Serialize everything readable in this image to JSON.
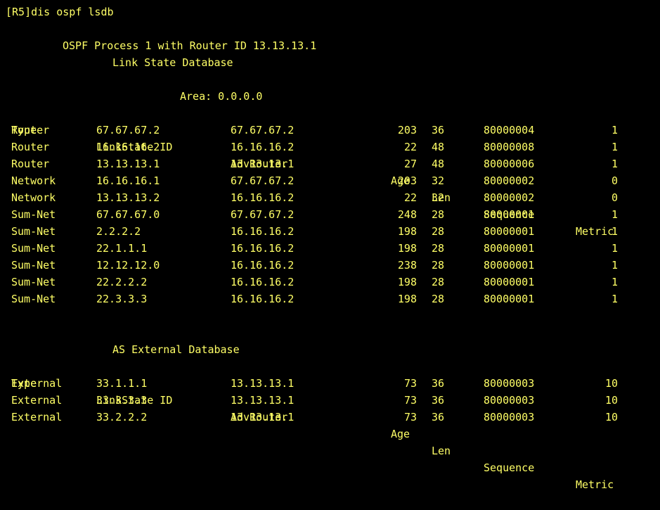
{
  "colors": {
    "background": "#000000",
    "text": "#ffff66"
  },
  "command": "[R5]dis ospf lsdb",
  "process_line": "OSPF Process 1 with Router ID 13.13.13.1",
  "database_title": "Link State Database",
  "area_line": "Area: 0.0.0.0",
  "headers": {
    "type": "Type",
    "lsid": "LinkState ID",
    "adv": "AdvRouter",
    "age": "Age",
    "len": "Len",
    "seq": "Sequence",
    "metric": "Metric"
  },
  "area_rows": [
    {
      "type": "Router",
      "lsid": "67.67.67.2",
      "adv": "67.67.67.2",
      "age": "203",
      "len": "36",
      "seq": "80000004",
      "metric": "1"
    },
    {
      "type": "Router",
      "lsid": "16.16.16.2",
      "adv": "16.16.16.2",
      "age": "22",
      "len": "48",
      "seq": "80000008",
      "metric": "1"
    },
    {
      "type": "Router",
      "lsid": "13.13.13.1",
      "adv": "13.13.13.1",
      "age": "27",
      "len": "48",
      "seq": "80000006",
      "metric": "1"
    },
    {
      "type": "Network",
      "lsid": "16.16.16.1",
      "adv": "67.67.67.2",
      "age": "203",
      "len": "32",
      "seq": "80000002",
      "metric": "0"
    },
    {
      "type": "Network",
      "lsid": "13.13.13.2",
      "adv": "16.16.16.2",
      "age": "22",
      "len": "32",
      "seq": "80000002",
      "metric": "0"
    },
    {
      "type": "Sum-Net",
      "lsid": "67.67.67.0",
      "adv": "67.67.67.2",
      "age": "248",
      "len": "28",
      "seq": "80000001",
      "metric": "1"
    },
    {
      "type": "Sum-Net",
      "lsid": "2.2.2.2",
      "adv": "16.16.16.2",
      "age": "198",
      "len": "28",
      "seq": "80000001",
      "metric": "1"
    },
    {
      "type": "Sum-Net",
      "lsid": "22.1.1.1",
      "adv": "16.16.16.2",
      "age": "198",
      "len": "28",
      "seq": "80000001",
      "metric": "1"
    },
    {
      "type": "Sum-Net",
      "lsid": "12.12.12.0",
      "adv": "16.16.16.2",
      "age": "238",
      "len": "28",
      "seq": "80000001",
      "metric": "1"
    },
    {
      "type": "Sum-Net",
      "lsid": "22.2.2.2",
      "adv": "16.16.16.2",
      "age": "198",
      "len": "28",
      "seq": "80000001",
      "metric": "1"
    },
    {
      "type": "Sum-Net",
      "lsid": "22.3.3.3",
      "adv": "16.16.16.2",
      "age": "198",
      "len": "28",
      "seq": "80000001",
      "metric": "1"
    }
  ],
  "external_title": "AS External Database",
  "external_rows": [
    {
      "type": "External",
      "lsid": "33.1.1.1",
      "adv": "13.13.13.1",
      "age": "73",
      "len": "36",
      "seq": "80000003",
      "metric": "10"
    },
    {
      "type": "External",
      "lsid": "33.3.3.3",
      "adv": "13.13.13.1",
      "age": "73",
      "len": "36",
      "seq": "80000003",
      "metric": "10"
    },
    {
      "type": "External",
      "lsid": "33.2.2.2",
      "adv": "13.13.13.1",
      "age": "73",
      "len": "36",
      "seq": "80000003",
      "metric": "10"
    }
  ]
}
